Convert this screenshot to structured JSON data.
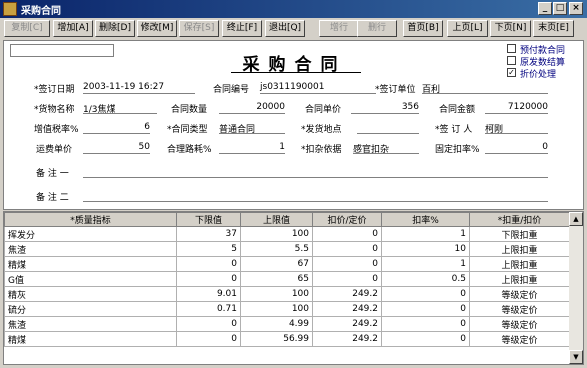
{
  "window": {
    "title": "采购合同"
  },
  "toolbar": {
    "copy": "复制[C]",
    "add": "增加[A]",
    "delete": "删除[D]",
    "modify": "修改[M]",
    "save": "保存[S]",
    "abort": "终止[F]",
    "exit": "退出[Q]",
    "add_row": "增行",
    "delete_row": "删行",
    "first": "首页[B]",
    "prev": "上页[L]",
    "next": "下页[N]",
    "last": "末页[E]"
  },
  "form": {
    "title": "采购合同",
    "checkboxes": [
      {
        "label": "预付款合同",
        "checked": false
      },
      {
        "label": "原发数结算",
        "checked": false
      },
      {
        "label": "折价处理",
        "checked": true
      }
    ],
    "fields": {
      "sign_date_label": "*签订日期",
      "sign_date": "2003-11-19 16:27",
      "contract_no_label": "合同编号",
      "contract_no": "js0311190001",
      "sign_unit_label": "*签订单位",
      "sign_unit": "百利",
      "goods_label": "*货物名称",
      "goods": "1/3焦煤",
      "qty_label": "合同数量",
      "qty": "20000",
      "price_label": "合同单价",
      "price": "356",
      "amount_label": "合同金额",
      "amount": "7120000",
      "vat_label": "增值税率%",
      "vat": "6",
      "type_label": "*合同类型",
      "type": "普通合同",
      "ship_label": "*发货地点",
      "ship": "",
      "signer_label": "*签 订 人",
      "signer": "柯刚",
      "freight_label": "运费单价",
      "freight": "50",
      "loss_label": "合理路耗%",
      "loss": "1",
      "deduct_label": "*扣杂依据",
      "deduct": "感官扣杂",
      "fixed_label": "固定扣率%",
      "fixed": "0",
      "remark1_label": "备 注 一",
      "remark1": "",
      "remark2_label": "备 注 二",
      "remark2": ""
    }
  },
  "grid": {
    "headers": [
      "*质量指标",
      "下限值",
      "上限值",
      "扣价/定价",
      "扣率%",
      "*扣重/扣价"
    ],
    "rows": [
      [
        "挥发分",
        "37",
        "100",
        "0",
        "1",
        "下限扣重"
      ],
      [
        "焦渣",
        "5",
        "5.5",
        "0",
        "10",
        "上限扣重"
      ],
      [
        "精煤",
        "0",
        "67",
        "0",
        "1",
        "上限扣重"
      ],
      [
        "G值",
        "0",
        "65",
        "0",
        "0.5",
        "上限扣重"
      ],
      [
        "精灰",
        "9.01",
        "100",
        "249.2",
        "0",
        "等级定价"
      ],
      [
        "硫分",
        "0.71",
        "100",
        "249.2",
        "0",
        "等级定价"
      ],
      [
        "焦渣",
        "0",
        "4.99",
        "249.2",
        "0",
        "等级定价"
      ],
      [
        "精煤",
        "0",
        "56.99",
        "249.2",
        "0",
        "等级定价"
      ]
    ]
  }
}
